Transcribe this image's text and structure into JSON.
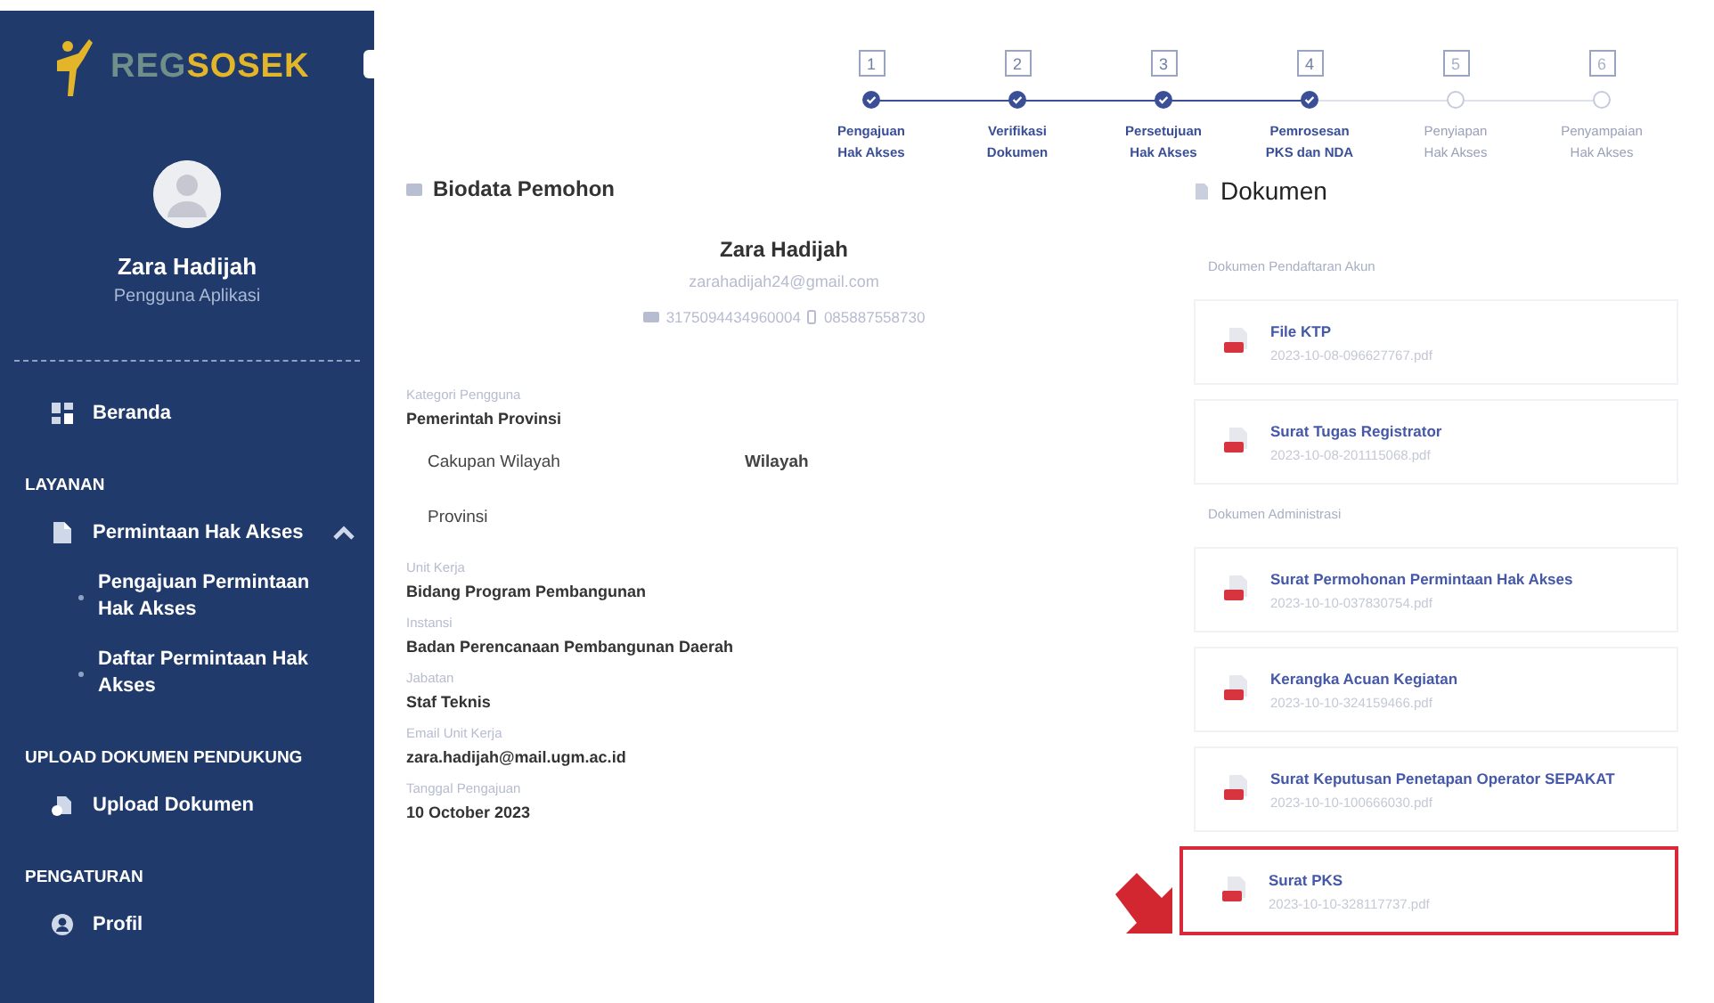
{
  "sidebar": {
    "logo": {
      "prefix": "REG",
      "suffix": "SOSEK"
    },
    "user": {
      "name": "Zara Hadijah",
      "role": "Pengguna Aplikasi"
    },
    "items": [
      {
        "kind": "item",
        "label": "Beranda"
      },
      {
        "kind": "section",
        "label": "LAYANAN"
      },
      {
        "kind": "item",
        "label": "Permintaan Hak Akses",
        "expanded": true
      },
      {
        "kind": "subitem",
        "label": "Pengajuan Permintaan Hak Akses"
      },
      {
        "kind": "subitem",
        "label": "Daftar Permintaan Hak Akses"
      },
      {
        "kind": "section",
        "label": "UPLOAD DOKUMEN PENDUKUNG"
      },
      {
        "kind": "item",
        "label": "Upload Dokumen"
      },
      {
        "kind": "section",
        "label": "PENGATURAN"
      },
      {
        "kind": "item",
        "label": "Profil"
      }
    ]
  },
  "stepper": [
    {
      "number": "1",
      "label": "Pengajuan Hak Akses",
      "done": true
    },
    {
      "number": "2",
      "label": "Verifikasi Dokumen",
      "done": true
    },
    {
      "number": "3",
      "label": "Persetujuan Hak Akses",
      "done": true
    },
    {
      "number": "4",
      "label": "Pemrosesan PKS dan NDA",
      "done": true
    },
    {
      "number": "5",
      "label": "Penyiapan Hak Akses",
      "done": false
    },
    {
      "number": "6",
      "label": "Penyampaian Hak Akses",
      "done": false
    }
  ],
  "biodata": {
    "title": "Biodata Pemohon",
    "name": "Zara Hadijah",
    "email": "zarahadijah24@gmail.com",
    "nik": "3175094434960004",
    "phone": "085887558730",
    "fields_top": [
      {
        "label": "Kategori Pengguna",
        "value": "Pemerintah Provinsi"
      }
    ],
    "region": {
      "headers": [
        "Cakupan Wilayah",
        "Wilayah"
      ],
      "rows": [
        [
          "Provinsi"
        ]
      ]
    },
    "fields": [
      {
        "label": "Unit Kerja",
        "value": "Bidang Program Pembangunan"
      },
      {
        "label": "Instansi",
        "value": "Badan Perencanaan Pembangunan Daerah"
      },
      {
        "label": "Jabatan",
        "value": "Staf Teknis"
      },
      {
        "label": "Email Unit Kerja",
        "value": "zara.hadijah@mail.ugm.ac.id"
      },
      {
        "label": "Tanggal Pengajuan",
        "value": "10 October 2023"
      }
    ]
  },
  "documents": {
    "title": "Dokumen",
    "groups": [
      {
        "label": "Dokumen Pendaftaran Akun",
        "files": [
          {
            "name": "File KTP",
            "file": "2023-10-08-096627767.pdf",
            "highlighted": false
          },
          {
            "name": "Surat Tugas Registrator",
            "file": "2023-10-08-201115068.pdf",
            "highlighted": false
          }
        ]
      },
      {
        "label": "Dokumen Administrasi",
        "files": [
          {
            "name": "Surat Permohonan Permintaan Hak Akses",
            "file": "2023-10-10-037830754.pdf",
            "highlighted": false
          },
          {
            "name": "Kerangka Acuan Kegiatan",
            "file": "2023-10-10-324159466.pdf",
            "highlighted": false
          },
          {
            "name": "Surat Keputusan Penetapan Operator SEPAKAT",
            "file": "2023-10-10-100666030.pdf",
            "highlighted": false
          },
          {
            "name": "Surat PKS",
            "file": "2023-10-10-328117737.pdf",
            "highlighted": true
          }
        ]
      }
    ]
  }
}
